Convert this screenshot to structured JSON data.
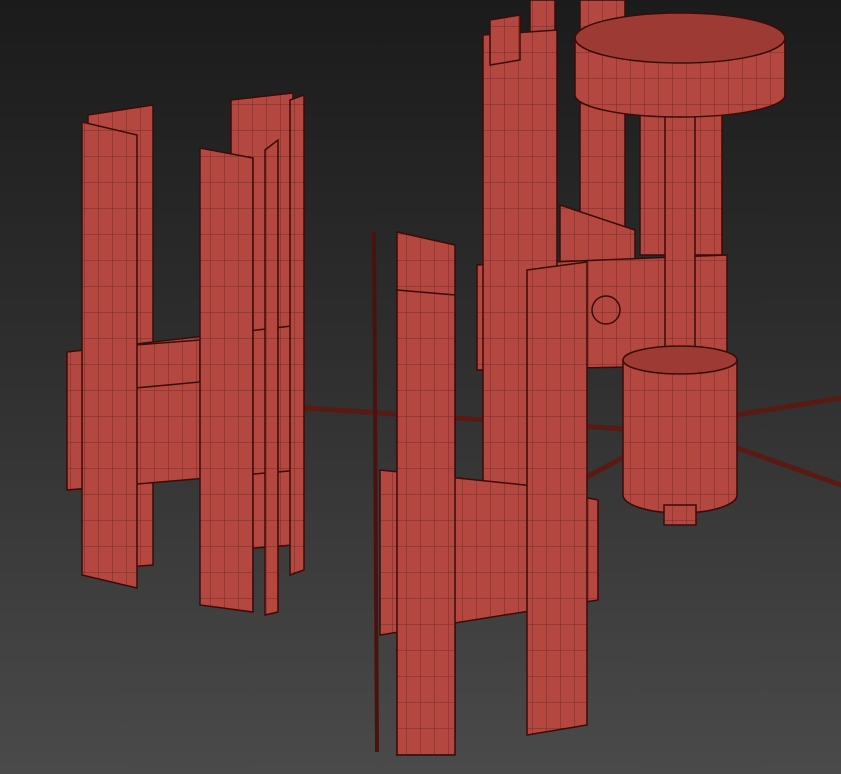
{
  "viewport": {
    "label": "3D viewport",
    "model_color": "#b4473f",
    "wire_color": "#3a0c08",
    "background_top": "#1b1b1b",
    "background_bottom": "#4a4a4a"
  }
}
